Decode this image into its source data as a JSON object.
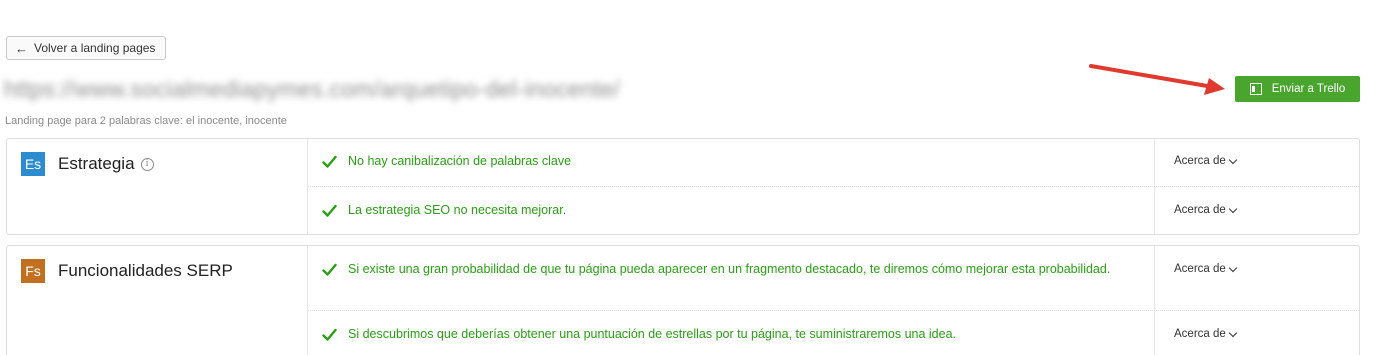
{
  "header": {
    "back_label": "Volver a landing pages",
    "url": "https://www.socialmediapymes.com/arquetipo-del-inocente/",
    "subtitle": "Landing page para 2 palabras clave: el inocente, inocente",
    "trello_label": "Enviar a Trello"
  },
  "colors": {
    "success_text": "#2a9e14",
    "trello_button": "#4aa52e",
    "strategy_badge": "#2c8ccf",
    "serp_badge": "#c0701e",
    "annotation_arrow": "#e03a2f"
  },
  "sections": [
    {
      "badge": "Es",
      "title": "Estrategia",
      "has_info": true,
      "items": [
        {
          "text": "No hay canibalización de palabras clave",
          "action": "Acerca de"
        },
        {
          "text": "La estrategia SEO no necesita mejorar.",
          "action": "Acerca de"
        }
      ]
    },
    {
      "badge": "Fs",
      "title": "Funcionalidades SERP",
      "has_info": false,
      "items": [
        {
          "text": "Si existe una gran probabilidad de que tu página pueda aparecer en un fragmento destacado, te diremos cómo mejorar esta probabilidad.",
          "action": "Acerca de"
        },
        {
          "text": "Si descubrimos que deberías obtener una puntuación de estrellas por tu página, te suministraremos una idea.",
          "action": "Acerca de"
        }
      ]
    }
  ],
  "icons": {
    "back": "arrow-left-icon",
    "trello": "trello-board-icon",
    "info": "info-circle-icon",
    "check": "check-icon",
    "chevron": "chevron-down-icon"
  }
}
